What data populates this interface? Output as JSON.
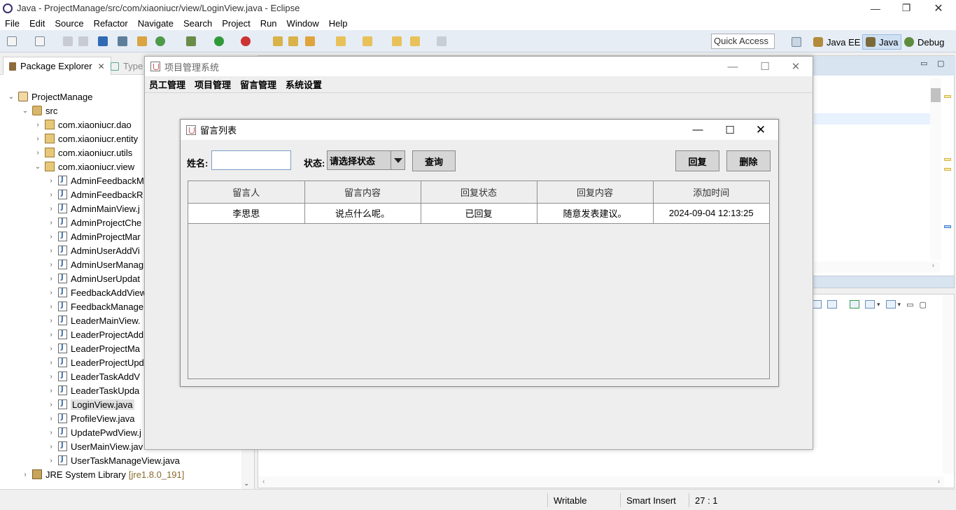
{
  "eclipse": {
    "title": "Java - ProjectManage/src/com/xiaoniucr/view/LoginView.java - Eclipse",
    "menu": [
      "File",
      "Edit",
      "Source",
      "Refactor",
      "Navigate",
      "Search",
      "Project",
      "Run",
      "Window",
      "Help"
    ],
    "quick_access": "Quick Access",
    "perspectives": [
      "Java EE",
      "Java",
      "Debug"
    ],
    "package_explorer": {
      "tab_label": "Package Explorer",
      "tab_close": "✕",
      "type_tab_label": "Type",
      "tree": [
        {
          "label": "ProjectManage",
          "icon": "project-icon",
          "expanded": true
        },
        {
          "label": "src",
          "icon": "source-folder-icon",
          "expanded": true
        },
        {
          "label": "com.xiaoniucr.dao",
          "icon": "package-icon"
        },
        {
          "label": "com.xiaoniucr.entity",
          "icon": "package-icon"
        },
        {
          "label": "com.xiaoniucr.utils",
          "icon": "package-icon"
        },
        {
          "label": "com.xiaoniucr.view",
          "icon": "package-icon",
          "expanded": true
        },
        {
          "label": "AdminFeedbackM",
          "icon": "java-file-icon"
        },
        {
          "label": "AdminFeedbackR",
          "icon": "java-file-icon"
        },
        {
          "label": "AdminMainView.j",
          "icon": "java-file-icon"
        },
        {
          "label": "AdminProjectChe",
          "icon": "java-file-icon"
        },
        {
          "label": "AdminProjectMar",
          "icon": "java-file-icon"
        },
        {
          "label": "AdminUserAddVi",
          "icon": "java-file-icon"
        },
        {
          "label": "AdminUserManag",
          "icon": "java-file-icon"
        },
        {
          "label": "AdminUserUpdat",
          "icon": "java-file-icon"
        },
        {
          "label": "FeedbackAddView",
          "icon": "java-file-icon"
        },
        {
          "label": "FeedbackManage",
          "icon": "java-file-icon"
        },
        {
          "label": "LeaderMainView.",
          "icon": "java-file-icon"
        },
        {
          "label": "LeaderProjectAdd",
          "icon": "java-file-icon"
        },
        {
          "label": "LeaderProjectMa",
          "icon": "java-file-icon"
        },
        {
          "label": "LeaderProjectUpd",
          "icon": "java-file-icon"
        },
        {
          "label": "LeaderTaskAddV",
          "icon": "java-file-icon"
        },
        {
          "label": "LeaderTaskUpda",
          "icon": "java-file-icon"
        },
        {
          "label": "LoginView.java",
          "icon": "java-file-icon",
          "selected": true
        },
        {
          "label": "ProfileView.java",
          "icon": "java-file-icon"
        },
        {
          "label": "UpdatePwdView.j",
          "icon": "java-file-icon"
        },
        {
          "label": "UserMainView.jav",
          "icon": "java-file-icon"
        },
        {
          "label": "UserTaskManageView.java",
          "icon": "java-file-icon"
        },
        {
          "label": "JRE System Library",
          "suffix": "[jre1.8.0_191]",
          "icon": "library-icon"
        }
      ]
    },
    "status_bar": {
      "writable": "Writable",
      "insert_mode": "Smart Insert",
      "position": "27 : 1"
    }
  },
  "app": {
    "title": "项目管理系统",
    "menu": [
      "员工管理",
      "项目管理",
      "留言管理",
      "系统设置"
    ],
    "dialog": {
      "title": "留言列表",
      "name_label": "姓名:",
      "name_value": "",
      "status_label": "状态:",
      "status_selected": "请选择状态",
      "query_button": "查询",
      "reply_button": "回复",
      "delete_button": "删除",
      "table": {
        "columns": [
          "留言人",
          "留言内容",
          "回复状态",
          "回复内容",
          "添加时间"
        ],
        "rows": [
          [
            "李思思",
            "说点什么呢。",
            "已回复",
            "随意发表建议。",
            "2024-09-04 12:13:25"
          ]
        ]
      }
    }
  },
  "colors": {
    "toolbar_bg": "#e6edf5",
    "selection": "#e0e0e0",
    "perspective_active": "#cfe0f3"
  }
}
